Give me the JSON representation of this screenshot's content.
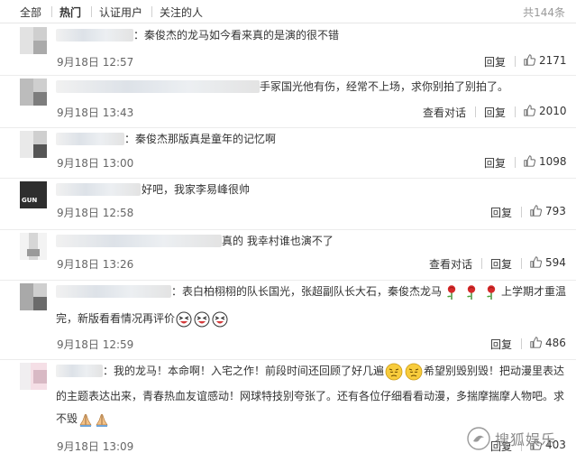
{
  "tabs": [
    "全部",
    "热门",
    "认证用户",
    "关注的人"
  ],
  "total": "共144条",
  "comments": [
    {
      "text": "：秦俊杰的龙马如今看来真的是演的很不错",
      "time": "9月18日 12:57",
      "reply": "回复",
      "likes": "2171"
    },
    {
      "text": "手冢国光他有伤，经常不上场，求你别拍了别拍了。",
      "time": "9月18日 13:43",
      "view": "查看对话",
      "reply": "回复",
      "likes": "2010"
    },
    {
      "text": "：秦俊杰那版真是童年的记忆啊",
      "time": "9月18日 13:00",
      "reply": "回复",
      "likes": "1098"
    },
    {
      "text": "好吧，我家李易峰很帅",
      "time": "9月18日 12:58",
      "reply": "回复",
      "likes": "793",
      "avatar_text": "GUN"
    },
    {
      "text": "真的 我幸村谁也演不了",
      "time": "9月18日 13:26",
      "view": "查看对话",
      "reply": "回复",
      "likes": "594"
    },
    {
      "line1": "：表白柏栩栩的队长国光，张超副队长大石，秦俊杰龙马",
      "line1_tail": "上学期才重温",
      "line2": "完，新版看看情况再评价",
      "time": "9月18日 12:59",
      "reply": "回复",
      "likes": "486"
    },
    {
      "line1": "：我的龙马！本命啊！入宅之作！前段时间还回顾了好几遍",
      "line1_tail": "希望别毁别毁！把动漫里表达",
      "line2": "的主题表达出来，青春热血友谊感动！网球特技别夸张了。还有各位仔细看看动漫，多揣摩揣摩人物吧。求",
      "line3": "不毁",
      "time": "9月18日 13:09",
      "reply": "回复",
      "likes": "403"
    }
  ],
  "watermark": "搜狐娱乐",
  "icons": {
    "like": "thumbs-up-icon",
    "rose": "rose-icon",
    "laugh": "laughing-face-icon",
    "sad": "crying-face-icon",
    "pray": "praying-hands-icon",
    "watermark": "sohu-fox-logo-icon"
  }
}
